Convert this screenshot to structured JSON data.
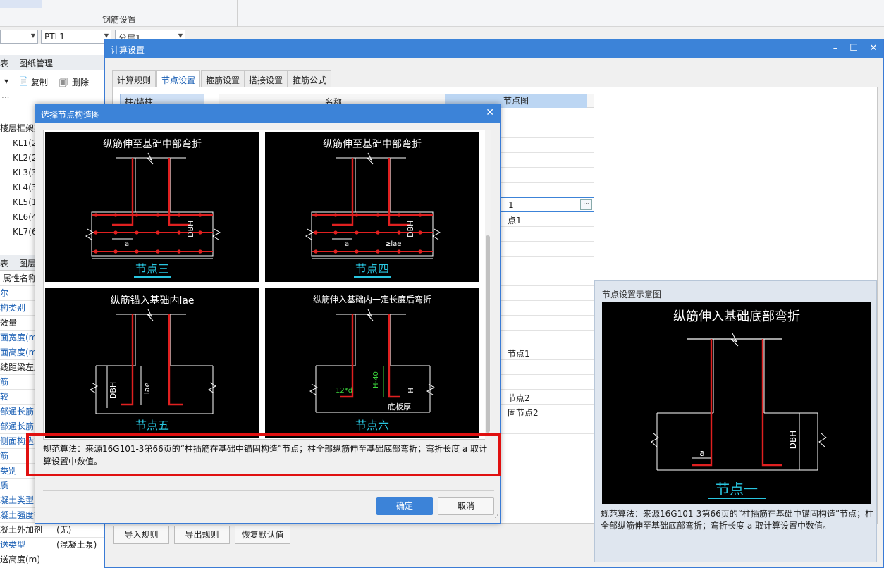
{
  "ribbon": {
    "section_label": "钢筋设置"
  },
  "toolbar_combos": {
    "component": "PTL1",
    "floor": "分层1"
  },
  "left_panel": {
    "tabs": [
      "表",
      "图纸管理"
    ],
    "actions": {
      "copy": "复制",
      "delete": "删除"
    },
    "search_placeholder": "...",
    "tree_root": "楼层框架梁",
    "tree_items": [
      "KL1(2",
      "KL2(2",
      "KL3(3",
      "KL4(3",
      "KL5(1",
      "KL6(4",
      "KL7(6"
    ],
    "prop_tabs": [
      "表",
      "图层"
    ],
    "prop_header": "属性名称",
    "props": [
      {
        "name": "尔",
        "value": ""
      },
      {
        "name": "构类别",
        "value": ""
      },
      {
        "name": "效量",
        "value": ""
      },
      {
        "name": "面宽度(mm",
        "value": ""
      },
      {
        "name": "面高度(mm",
        "value": ""
      },
      {
        "name": "线距梁左边",
        "value": ""
      },
      {
        "name": "筋",
        "value": ""
      },
      {
        "name": "较",
        "value": ""
      },
      {
        "name": "部通长筋",
        "value": ""
      },
      {
        "name": "部通长筋",
        "value": ""
      },
      {
        "name": "侧面构造或受",
        "value": ""
      },
      {
        "name": "筋",
        "value": ""
      },
      {
        "name": "类别",
        "value": ""
      },
      {
        "name": "质",
        "value": ""
      },
      {
        "name": "凝土类型",
        "value": ""
      },
      {
        "name": "凝土强度等",
        "value": ""
      },
      {
        "name": "凝土外加剂",
        "value": "(无)"
      },
      {
        "name": "送类型",
        "value": "(混凝土泵)"
      },
      {
        "name": "送高度(m)",
        "value": ""
      }
    ]
  },
  "calc_window": {
    "title": "计算设置",
    "tabs": [
      "计算规则",
      "节点设置",
      "箍筋设置",
      "搭接设置",
      "箍筋公式"
    ],
    "active_tab": "节点设置",
    "left_label": "柱/墙柱",
    "col_name": "名称",
    "col_node": "节点图",
    "rows": [
      "",
      "",
      "",
      "",
      "",
      "",
      "1",
      "点1",
      "",
      "",
      "",
      "",
      "",
      "",
      "",
      "",
      "节点1",
      "",
      "",
      "节点2",
      "固节点2",
      ""
    ],
    "selected_row": 6,
    "preview": {
      "title": "节点设置示意图",
      "image_title": "纵筋伸入基础底部弯折",
      "node_label": "节点一",
      "desc": "规范算法：来源16G101-3第66页的“柱插筋在基础中锚固构造”节点；柱全部纵筋伸至基础底部弯折；弯折长度 a 取计算设置中数值。"
    },
    "footer_buttons": [
      "导入规则",
      "导出规则",
      "恢复默认值"
    ]
  },
  "node_dialog": {
    "title": "选择节点构造图",
    "close": "✕",
    "nodes": [
      {
        "title": "纵筋伸至基础中部弯折",
        "label": "节点三"
      },
      {
        "title": "纵筋伸至基础中部弯折",
        "label": "节点四"
      },
      {
        "title": "纵筋锚入基础内lae",
        "label": "节点五"
      },
      {
        "title": "纵筋伸入基础内一定长度后弯折",
        "label": "节点六"
      }
    ],
    "desc": "规范算法：来源16G101-3第66页的“柱插筋在基础中锚固构造”节点；柱全部纵筋伸至基础底部弯折；弯折长度 a 取计算设置中数值。",
    "ok": "确定",
    "cancel": "取消"
  },
  "colors": {
    "accent": "#3c83d8",
    "highlight": "#e01010",
    "cad_bg": "#000000",
    "rebar": "#e02020",
    "label_cyan": "#29c6e0"
  }
}
